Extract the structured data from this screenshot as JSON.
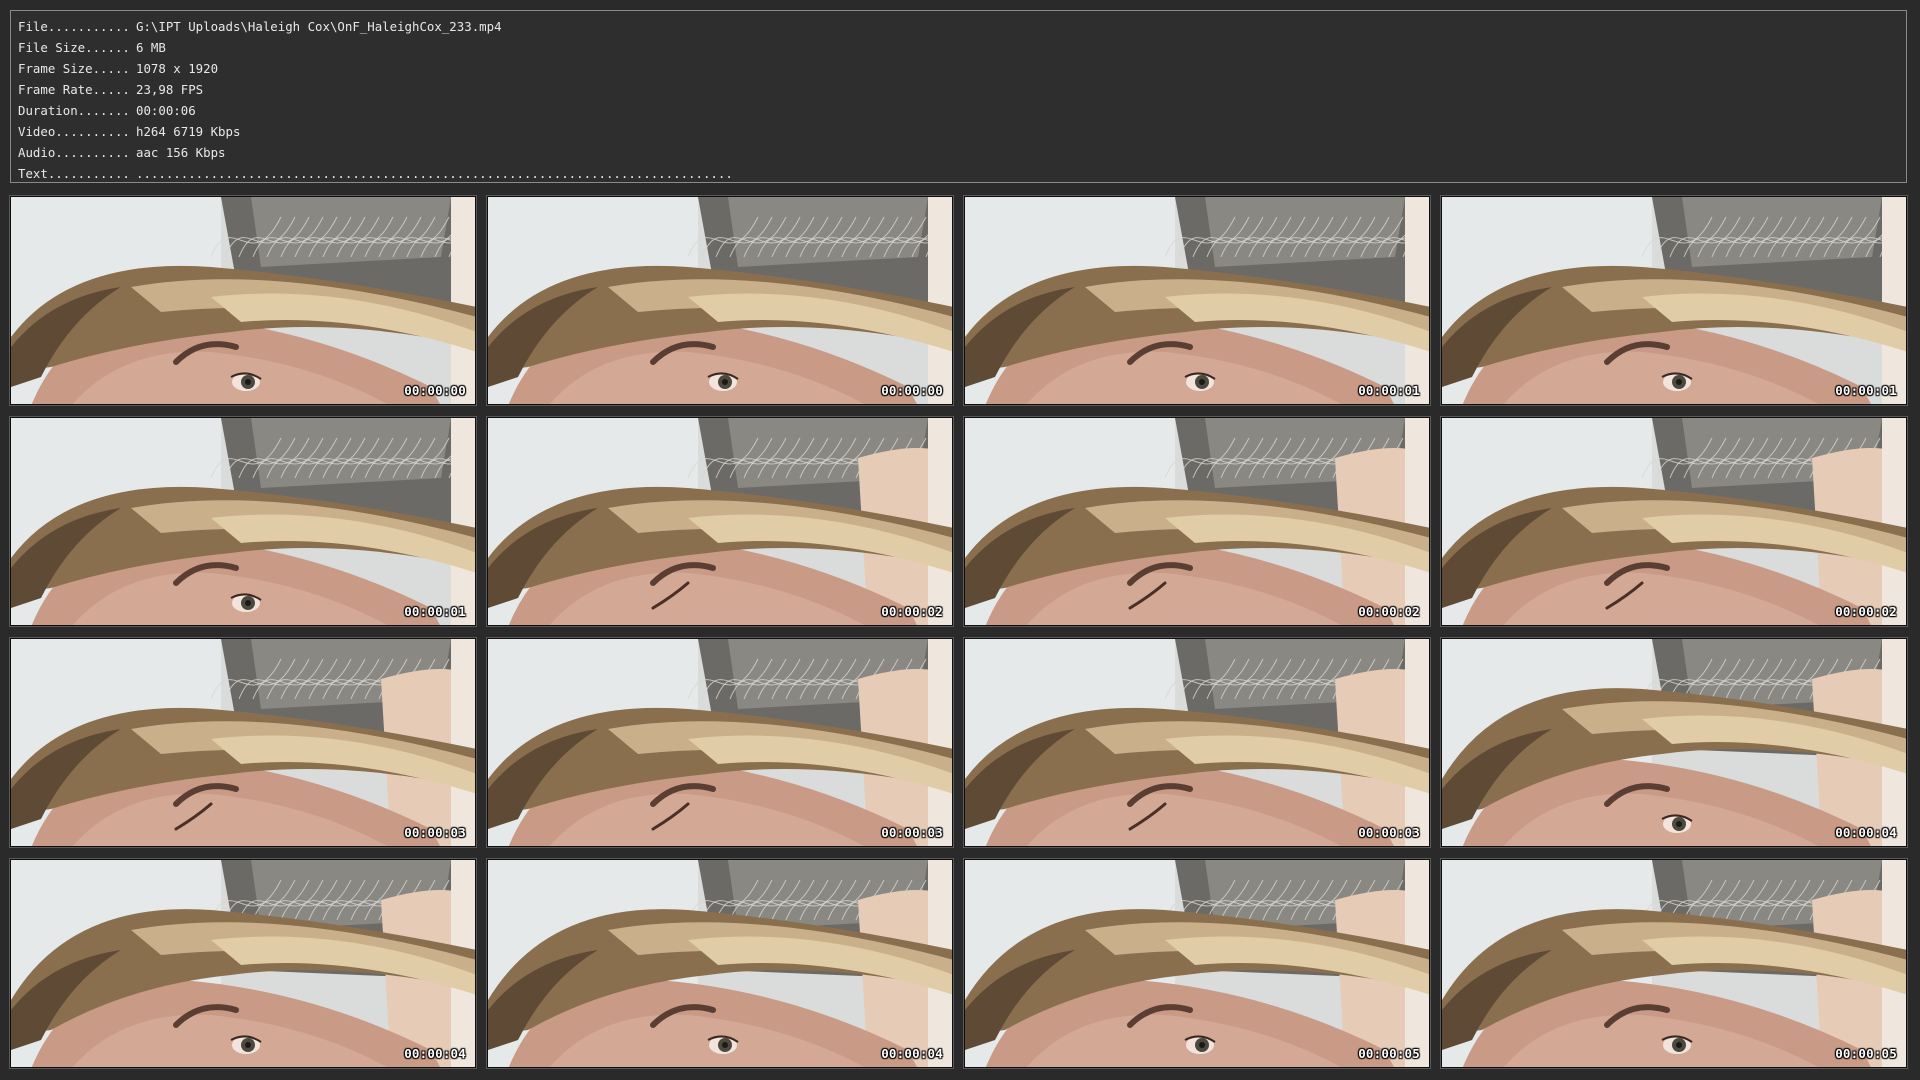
{
  "info": [
    {
      "key": "File...........",
      "value": "G:\\IPT Uploads\\Haleigh Cox\\OnF_HaleighCox_233.mp4"
    },
    {
      "key": "File Size......",
      "value": "6 MB"
    },
    {
      "key": "Frame Size.....",
      "value": "1078 x 1920"
    },
    {
      "key": "Frame Rate.....",
      "value": "23,98 FPS"
    },
    {
      "key": "Duration.......",
      "value": "00:00:06"
    },
    {
      "key": "Video..........",
      "value": "h264 6719 Kbps"
    },
    {
      "key": "Audio..........",
      "value": "aac 156 Kbps"
    },
    {
      "key": "Text...........",
      "value": "................................................................................"
    }
  ],
  "thumbnails": [
    {
      "timestamp": "00:00:00",
      "scene": "eye-open"
    },
    {
      "timestamp": "00:00:00",
      "scene": "eye-open"
    },
    {
      "timestamp": "00:00:01",
      "scene": "eye-open"
    },
    {
      "timestamp": "00:00:01",
      "scene": "eye-open"
    },
    {
      "timestamp": "00:00:01",
      "scene": "eye-open"
    },
    {
      "timestamp": "00:00:02",
      "scene": "eye-closed"
    },
    {
      "timestamp": "00:00:02",
      "scene": "eye-closed"
    },
    {
      "timestamp": "00:00:02",
      "scene": "eye-closed"
    },
    {
      "timestamp": "00:00:03",
      "scene": "eye-closed"
    },
    {
      "timestamp": "00:00:03",
      "scene": "eye-closed"
    },
    {
      "timestamp": "00:00:03",
      "scene": "eye-closed"
    },
    {
      "timestamp": "00:00:04",
      "scene": "eye-open-hair"
    },
    {
      "timestamp": "00:00:04",
      "scene": "eye-open-hair"
    },
    {
      "timestamp": "00:00:04",
      "scene": "eye-open-hair"
    },
    {
      "timestamp": "00:00:05",
      "scene": "eye-open-hair"
    },
    {
      "timestamp": "00:00:05",
      "scene": "eye-open-hair"
    }
  ],
  "colors": {
    "background": "#2a2a2a",
    "panel_border": "#8a8a8a",
    "text": "#e8e8e8"
  }
}
